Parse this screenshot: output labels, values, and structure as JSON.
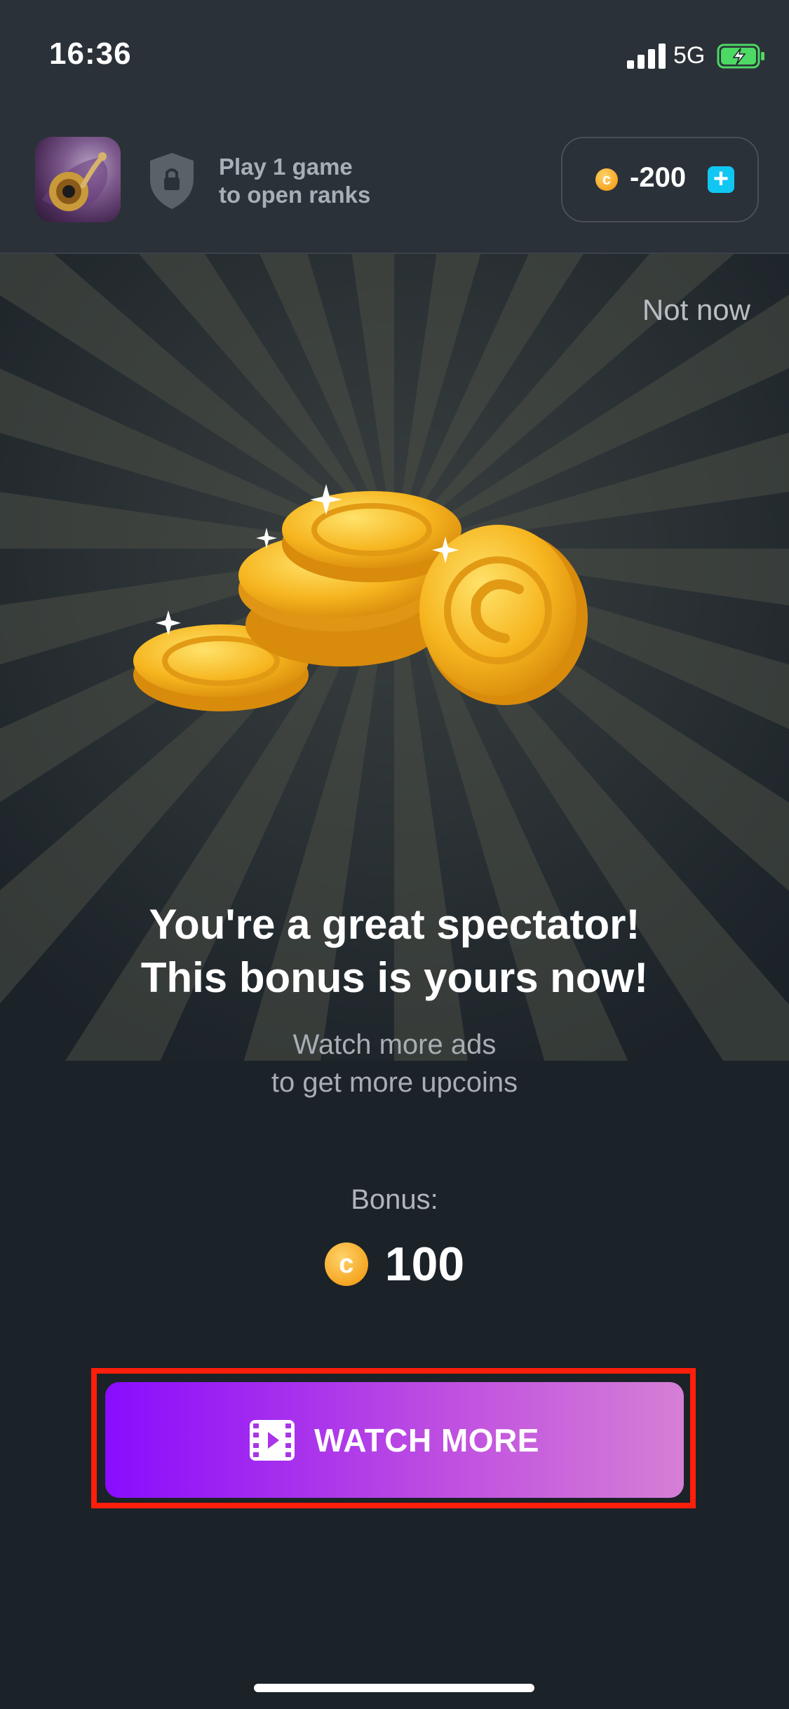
{
  "status_bar": {
    "time": "16:36",
    "network": "5G"
  },
  "header": {
    "rank_line1": "Play 1 game",
    "rank_line2": "to open ranks",
    "coin_balance": "-200",
    "coin_symbol": "c"
  },
  "popup": {
    "dismiss_label": "Not now",
    "title_line1": "You're a great spectator!",
    "title_line2": "This bonus is yours now!",
    "subtitle_line1": "Watch more ads",
    "subtitle_line2": "to get more upcoins",
    "bonus_label": "Bonus:",
    "bonus_value": "100",
    "watch_button_label": "WATCH MORE"
  },
  "colors": {
    "background": "#1b2228",
    "header_bg": "#2b3138",
    "accent_plus": "#10c7f4",
    "coin_gold": "#f5a623",
    "button_gradient_start": "#8a0cff",
    "button_gradient_end": "#d57fd6",
    "highlight_frame": "#ff1f0a"
  },
  "icons": [
    "signal-icon",
    "battery-charging-icon",
    "shield-lock-icon",
    "coin-icon",
    "plus-icon",
    "film-play-icon"
  ]
}
